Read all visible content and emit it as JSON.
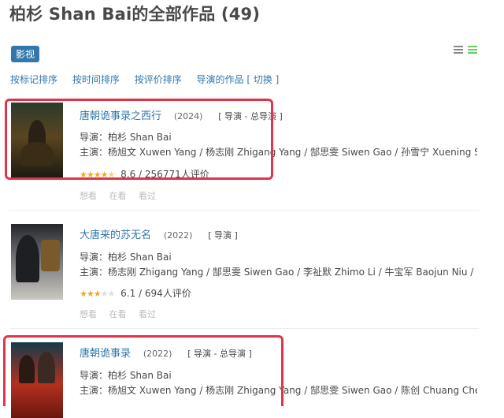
{
  "page": {
    "title": "柏杉 Shan Bai的全部作品 (49)",
    "category_tag": "影视"
  },
  "sort": {
    "by_marked": "按标记排序",
    "by_time": "按时间排序",
    "by_rating": "按评价排序",
    "directed_works": "导演的作品 [ 切换 ]"
  },
  "view_icons": [
    "list-view-icon",
    "grid-view-icon"
  ],
  "colors": {
    "link": "#3377aa",
    "highlight": "#e0344b",
    "star": "#f5a623"
  },
  "works": [
    {
      "title": "唐朝诡事录之西行",
      "year": "(2024)",
      "role": "[ 导演 - 总导演 ]",
      "director": "导演：柏杉 Shan Bai",
      "cast": "主演：杨旭文 Xuwen Yang / 杨志刚 Zhigang Yang / 郜思雯 Siwen Gao / 孙雪宁 Xuening Sun / 陈...",
      "stars": 4.5,
      "rating": "8.6 / 256771人评价",
      "actions": [
        "想看",
        "在看",
        "看过"
      ],
      "highlighted": true
    },
    {
      "title": "大唐来的苏无名",
      "year": "(2022)",
      "role": "[ 导演 ]",
      "director": "导演：柏杉 Shan Bai",
      "cast": "主演：杨志刚 Zhigang Yang / 郜思雯 Siwen Gao / 李祉默 Zhimo Li / 牛宝军 Baojun Niu / 张黎明 L...",
      "stars": 3,
      "rating": "6.1 / 694人评价",
      "actions": [
        "想看",
        "在看",
        "看过"
      ],
      "highlighted": false
    },
    {
      "title": "唐朝诡事录",
      "year": "(2022)",
      "role": "[ 导演 - 总导演 ]",
      "director": "导演：柏杉 Shan Bai",
      "cast": "主演：杨旭文 Xuwen Yang / 杨志刚 Zhigang Yang / 郜思雯 Siwen Gao / 陈创 Chuang Chen / 孙雪...",
      "highlighted": true
    }
  ]
}
